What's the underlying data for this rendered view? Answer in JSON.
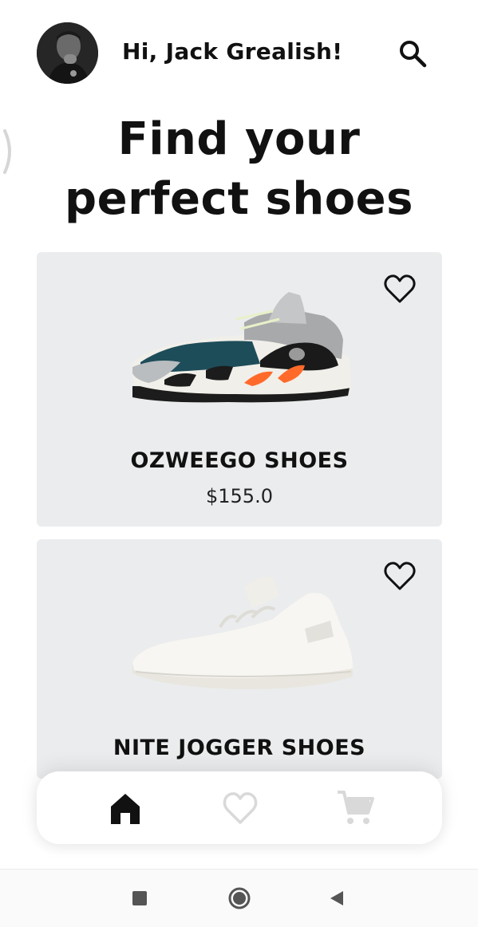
{
  "header": {
    "greeting": "Hi, Jack Grealish!",
    "avatar_icon": "user-avatar",
    "search_icon": "search-icon"
  },
  "headline": {
    "line1": "Find your",
    "line2": "perfect shoes"
  },
  "products": [
    {
      "name": "OZWEEGO SHOES",
      "price": "$155.0",
      "favorite_icon": "heart-outline-icon"
    },
    {
      "name": "NITE JOGGER SHOES",
      "price": "",
      "favorite_icon": "heart-outline-icon"
    }
  ],
  "bottom_nav": {
    "items": [
      {
        "icon": "home-icon",
        "active": true
      },
      {
        "icon": "heart-outline-icon",
        "active": false
      },
      {
        "icon": "cart-icon",
        "active": false
      }
    ],
    "active_color": "#111111",
    "inactive_color": "#d9d9d9"
  },
  "system_nav": {
    "items": [
      "recents-square-icon",
      "home-circle-icon",
      "back-triangle-icon"
    ]
  },
  "colors": {
    "background": "#ffffff",
    "card": "#ebeced",
    "text": "#111111"
  }
}
